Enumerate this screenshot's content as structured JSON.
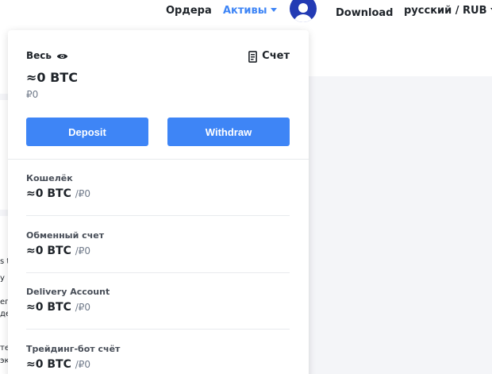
{
  "nav": {
    "orders": "Ордера",
    "assets": "Активы",
    "download": "Download",
    "language_currency": "русский / RUB"
  },
  "background_fragments": [
    "s t",
    "y b",
    "ег",
    "де",
    "те",
    "эк"
  ],
  "assets_dropdown": {
    "total_label": "Весь",
    "account_label": "Счет",
    "total_btc": "≈0 BTC",
    "total_fiat": "₽0",
    "deposit_label": "Deposit",
    "withdraw_label": "Withdraw",
    "accounts": [
      {
        "name": "Кошелёк",
        "btc": "≈0 BTC",
        "fiat": "/₽0"
      },
      {
        "name": "Обменный счет",
        "btc": "≈0 BTC",
        "fiat": "/₽0"
      },
      {
        "name": "Delivery Account",
        "btc": "≈0 BTC",
        "fiat": "/₽0"
      },
      {
        "name": "Трейдинг-бот счёт",
        "btc": "≈0 BTC",
        "fiat": "/₽0"
      }
    ]
  },
  "colors": {
    "accent": "#3e85f6",
    "avatar": "#233bb4"
  },
  "icons": {
    "assets_caret": "chevron-down-icon",
    "language_caret": "chevron-down-icon",
    "eye": "eye-icon",
    "account": "document-icon",
    "avatar": "user-icon"
  }
}
